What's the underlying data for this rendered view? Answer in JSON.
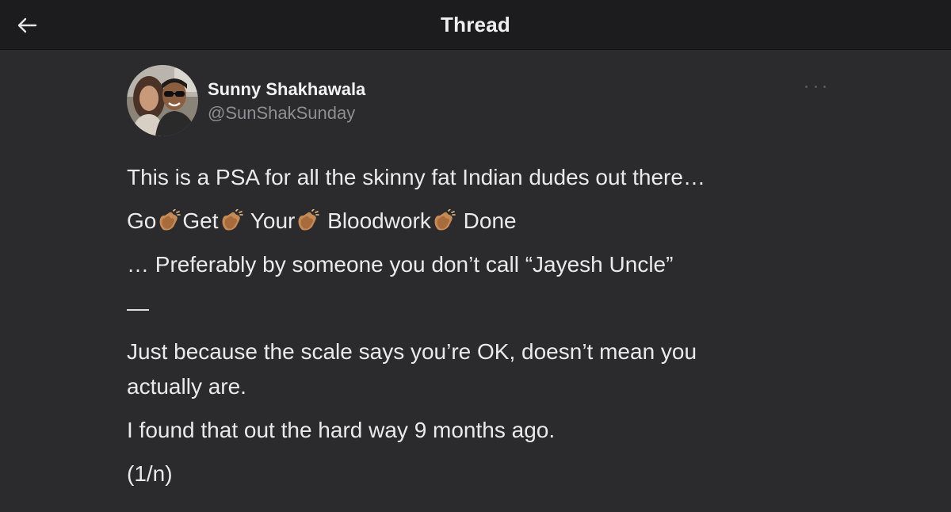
{
  "header": {
    "title": "Thread"
  },
  "tweet": {
    "author": {
      "name": "Sunny Shakhawala",
      "handle": "@SunShakSunday"
    },
    "lines": {
      "l1": "This is a PSA for all the skinny fat Indian dudes out there…",
      "l2_words": [
        "Go",
        "Get",
        "Your",
        "Bloodwork",
        "Done"
      ],
      "l3": "… Preferably by someone you don’t call “Jayesh Uncle”",
      "l4": "—",
      "l5a": "Just because the scale says you’re OK, doesn’t mean you",
      "l5b": "actually are.",
      "l6": "I found that out the hard way 9 months ago.",
      "l7": "(1/n)"
    },
    "emoji": "clapping-hands"
  },
  "colors": {
    "background": "#2b2b2e",
    "header": "#1c1c1e",
    "text": "#eaeaea",
    "muted": "#8e8e93"
  }
}
